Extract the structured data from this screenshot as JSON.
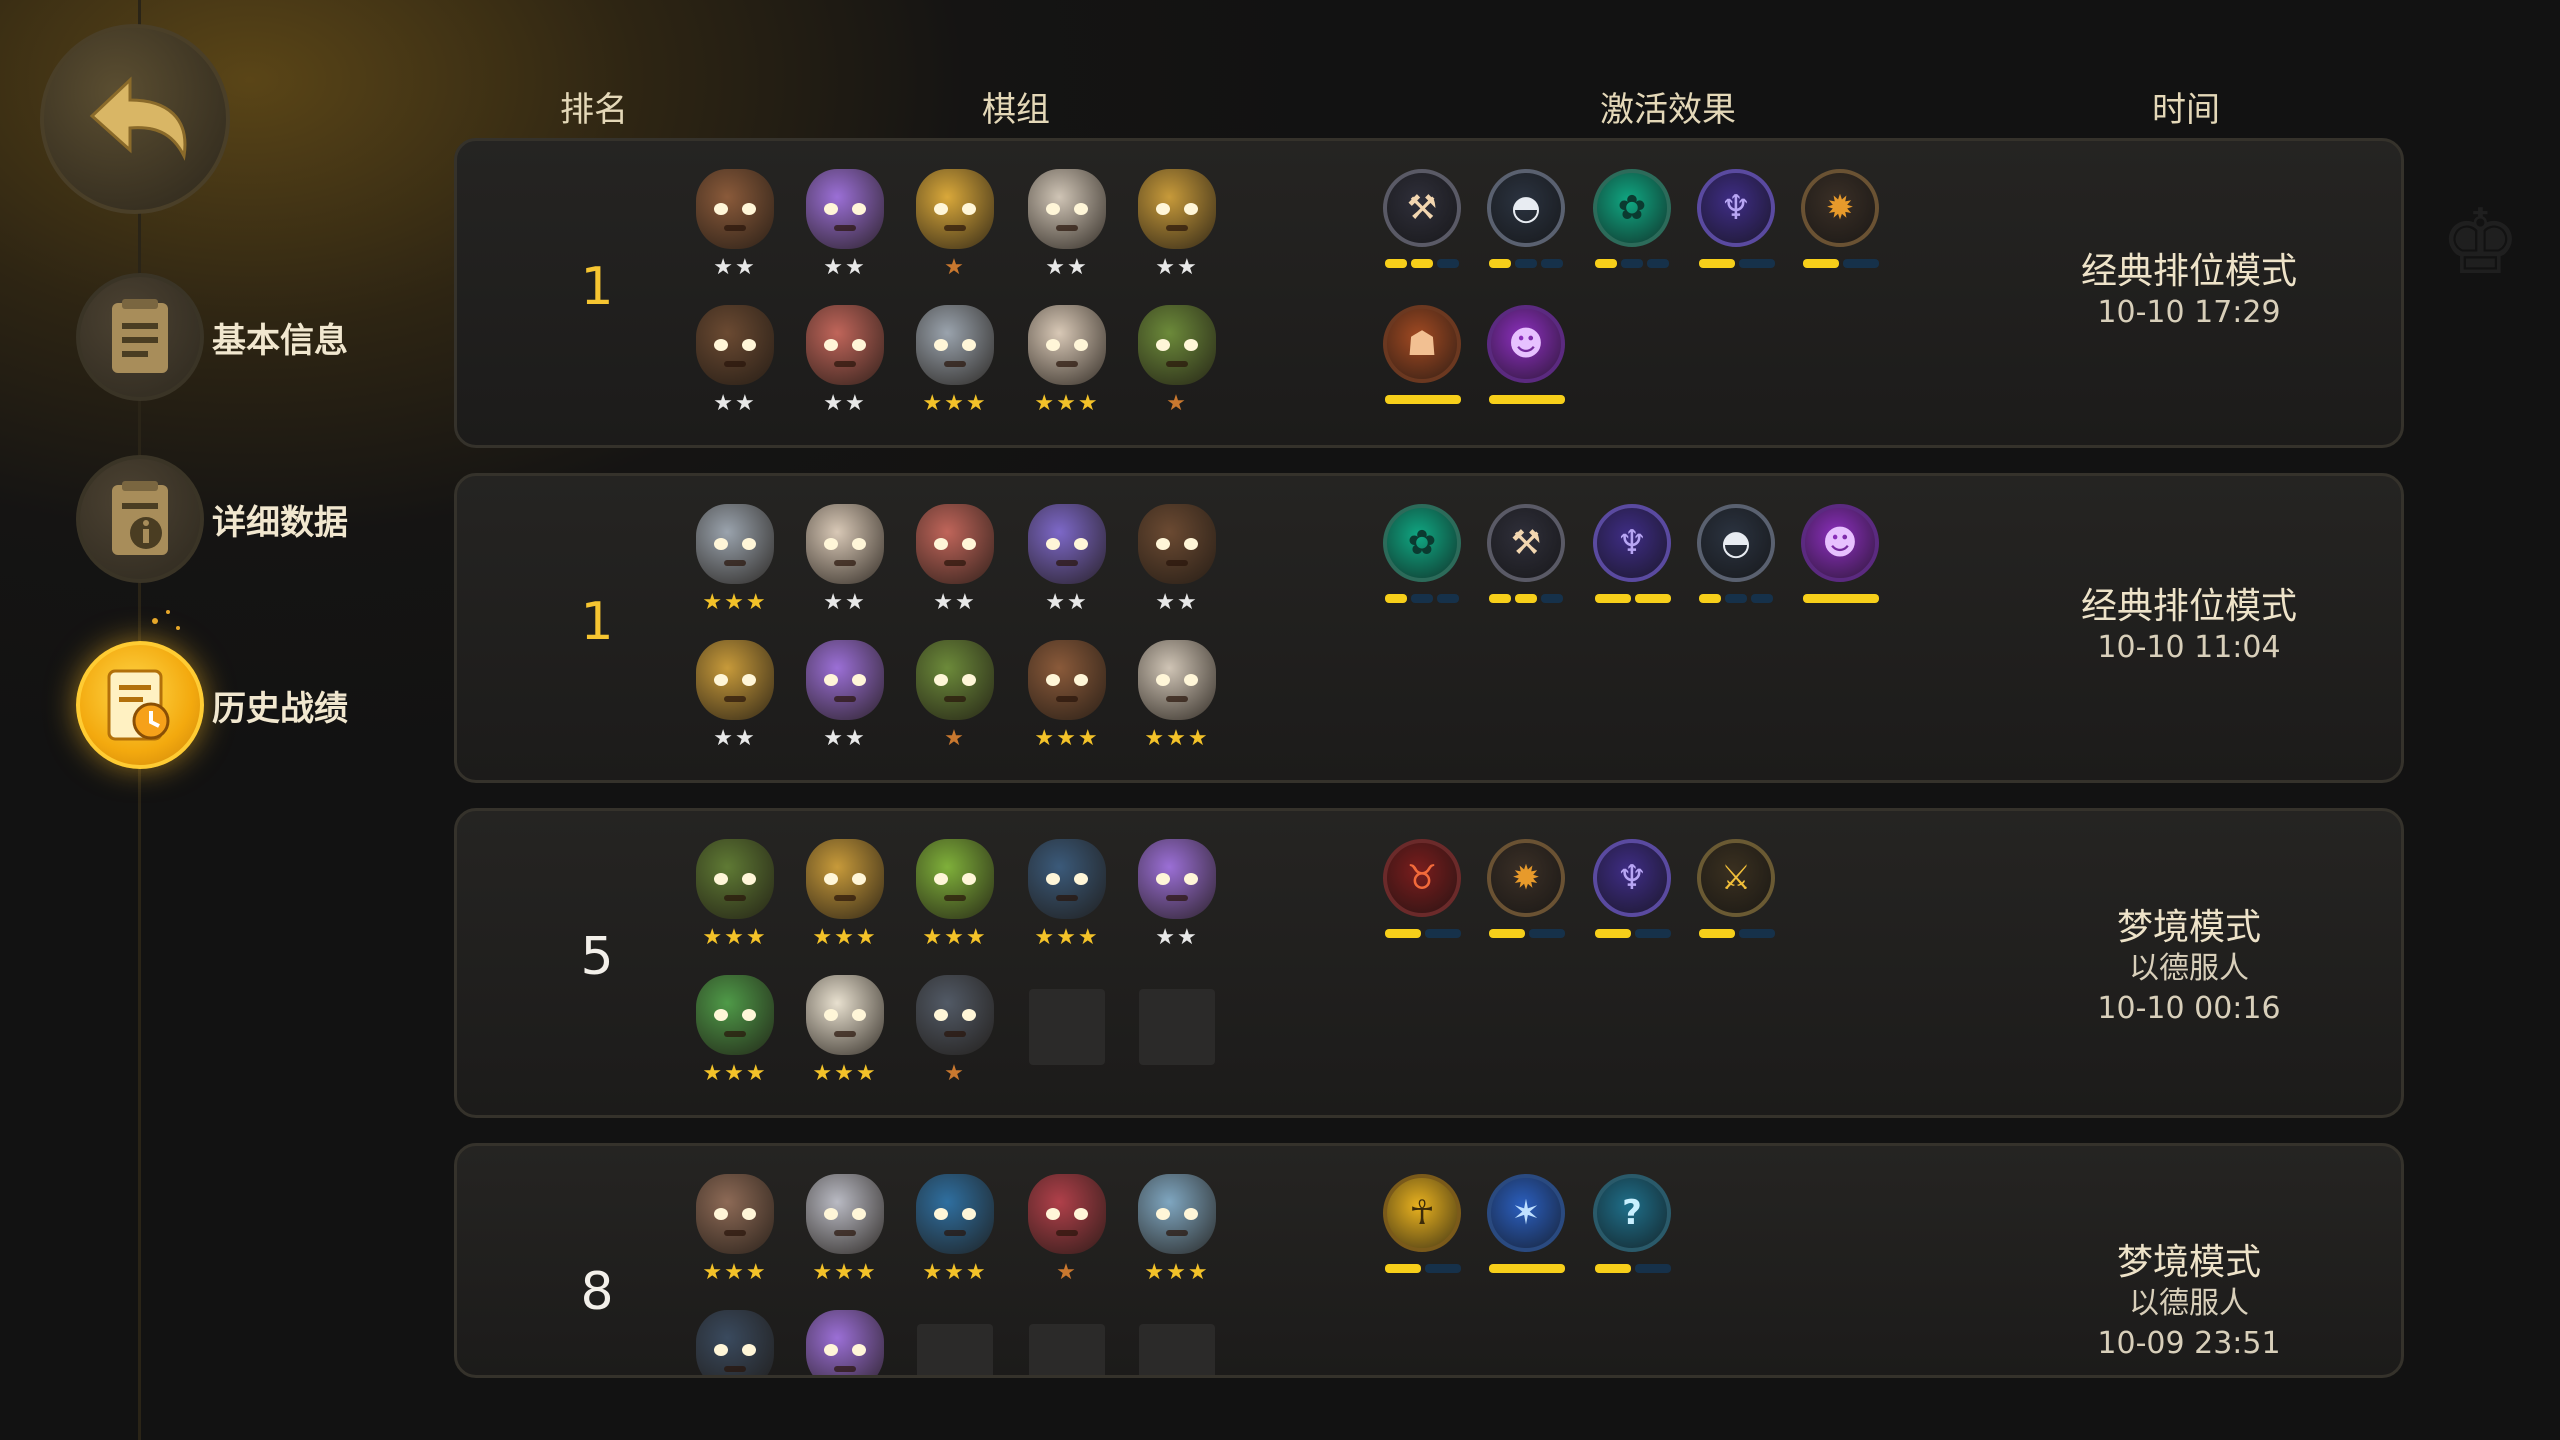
{
  "sidebar": {
    "back_icon": "back-arrow-icon",
    "items": [
      {
        "label": "基本信息",
        "icon": "document-icon",
        "active": false
      },
      {
        "label": "详细数据",
        "icon": "data-detail-icon",
        "active": false
      },
      {
        "label": "历史战绩",
        "icon": "history-clock-icon",
        "active": true
      }
    ]
  },
  "headers": {
    "rank": "排名",
    "lineup": "棋组",
    "effects": "激活效果",
    "time": "时间"
  },
  "colors": {
    "gold": "#f6c531",
    "accent": "#f7cf1a",
    "bar_off": "#16314a"
  },
  "records": [
    {
      "rank": "1",
      "mode": "经典排位模式",
      "sub": "",
      "time": "10-10 17:29",
      "pieces": [
        {
          "color": "#8a5a3a",
          "stars": 2
        },
        {
          "color": "#9b6fd6",
          "stars": 2
        },
        {
          "color": "#d9a83a",
          "stars": 1
        },
        {
          "color": "#cfc4b5",
          "stars": 2
        },
        {
          "color": "#c79a3a",
          "stars": 2
        },
        {
          "color": "#6b4a32",
          "stars": 2
        },
        {
          "color": "#c0655a",
          "stars": 2
        },
        {
          "color": "#9aa3ad",
          "stars": 3
        },
        {
          "color": "#d8c8b6",
          "stars": 3
        },
        {
          "color": "#6c8a3a",
          "stars": 1
        }
      ],
      "synergies": [
        {
          "icon": "axe-icon",
          "glyph": "⚒",
          "bg": "#2f2f3a",
          "fg": "#f2d6b0",
          "ring": "#5a5a66",
          "segments": 3,
          "active": 2,
          "row": 0
        },
        {
          "icon": "hat-icon",
          "glyph": "◓",
          "bg": "#2b3340",
          "fg": "#e8ecf2",
          "ring": "#5a6170",
          "segments": 3,
          "active": 1,
          "row": 0
        },
        {
          "icon": "paw-icon",
          "glyph": "✿",
          "bg": "#10a883",
          "fg": "#0b3a30",
          "ring": "#2c6b5a",
          "segments": 3,
          "active": 1,
          "row": 0
        },
        {
          "icon": "fish-icon",
          "glyph": "♆",
          "bg": "#3f2d86",
          "fg": "#b8a6f4",
          "ring": "#5a4aa0",
          "segments": 2,
          "active": 1,
          "row": 0
        },
        {
          "icon": "gear-icon",
          "glyph": "✹",
          "bg": "#3a2f26",
          "fg": "#e79a2b",
          "ring": "#6a5233",
          "segments": 2,
          "active": 1,
          "row": 0
        },
        {
          "icon": "horned-mask-icon",
          "glyph": "☗",
          "bg": "#a24a22",
          "fg": "#f2c092",
          "ring": "#6b3820",
          "segments": 1,
          "active": 1,
          "row": 1
        },
        {
          "icon": "demon-icon",
          "glyph": "☻",
          "bg": "#8d2fbf",
          "fg": "#e7c1ff",
          "ring": "#5b2a80",
          "segments": 1,
          "active": 1,
          "row": 1
        }
      ]
    },
    {
      "rank": "1",
      "mode": "经典排位模式",
      "sub": "",
      "time": "10-10 11:04",
      "pieces": [
        {
          "color": "#9aa3ad",
          "stars": 3
        },
        {
          "color": "#d8c8b6",
          "stars": 2
        },
        {
          "color": "#c0655a",
          "stars": 2
        },
        {
          "color": "#7d68c8",
          "stars": 2
        },
        {
          "color": "#6b4a32",
          "stars": 2
        },
        {
          "color": "#c79a3a",
          "stars": 2
        },
        {
          "color": "#9b6fd6",
          "stars": 2
        },
        {
          "color": "#6c8a3a",
          "stars": 1
        },
        {
          "color": "#8a5a3a",
          "stars": 3
        },
        {
          "color": "#cfc4b5",
          "stars": 3
        }
      ],
      "synergies": [
        {
          "icon": "paw-icon",
          "glyph": "✿",
          "bg": "#10a883",
          "fg": "#0b3a30",
          "ring": "#2c6b5a",
          "segments": 3,
          "active": 1,
          "row": 0
        },
        {
          "icon": "axe-icon",
          "glyph": "⚒",
          "bg": "#2f2f3a",
          "fg": "#f2d6b0",
          "ring": "#5a5a66",
          "segments": 3,
          "active": 2,
          "row": 0
        },
        {
          "icon": "fish-icon",
          "glyph": "♆",
          "bg": "#3f2d86",
          "fg": "#b8a6f4",
          "ring": "#5a4aa0",
          "segments": 2,
          "active": 2,
          "row": 0
        },
        {
          "icon": "hat-icon",
          "glyph": "◓",
          "bg": "#2b3340",
          "fg": "#e8ecf2",
          "ring": "#5a6170",
          "segments": 3,
          "active": 1,
          "row": 0
        },
        {
          "icon": "demon-icon",
          "glyph": "☻",
          "bg": "#8d2fbf",
          "fg": "#e7c1ff",
          "ring": "#5b2a80",
          "segments": 1,
          "active": 1,
          "row": 0
        }
      ]
    },
    {
      "rank": "5",
      "mode": "梦境模式",
      "sub": "以德服人",
      "time": "10-10 00:16",
      "pieces": [
        {
          "color": "#5f7a34",
          "stars": 3
        },
        {
          "color": "#c79a3a",
          "stars": 3
        },
        {
          "color": "#7fb03a",
          "stars": 3
        },
        {
          "color": "#3b5a7a",
          "stars": 3
        },
        {
          "color": "#9b6fd6",
          "stars": 2
        },
        {
          "color": "#4f9a48",
          "stars": 3
        },
        {
          "color": "#e8e0cf",
          "stars": 3
        },
        {
          "color": "#525a66",
          "stars": 1
        },
        {
          "empty": true
        },
        {
          "empty": true
        }
      ],
      "synergies": [
        {
          "icon": "bull-icon",
          "glyph": "♉",
          "bg": "#7a1d1d",
          "fg": "#f26a3a",
          "ring": "#6b2a2a",
          "segments": 2,
          "active": 1,
          "row": 0
        },
        {
          "icon": "gear-icon",
          "glyph": "✹",
          "bg": "#3a2f26",
          "fg": "#e79a2b",
          "ring": "#6a5233",
          "segments": 2,
          "active": 1,
          "row": 0
        },
        {
          "icon": "fish-icon",
          "glyph": "♆",
          "bg": "#3f2d86",
          "fg": "#b8a6f4",
          "ring": "#5a4aa0",
          "segments": 2,
          "active": 1,
          "row": 0
        },
        {
          "icon": "blades-icon",
          "glyph": "⚔",
          "bg": "#3a3020",
          "fg": "#f1bf3a",
          "ring": "#6a5a33",
          "segments": 2,
          "active": 1,
          "row": 0
        }
      ]
    },
    {
      "rank": "8",
      "mode": "梦境模式",
      "sub": "以德服人",
      "time": "10-09 23:51",
      "pieces": [
        {
          "color": "#8d6a56",
          "stars": 3
        },
        {
          "color": "#b9bac3",
          "stars": 3
        },
        {
          "color": "#2f6fa0",
          "stars": 3
        },
        {
          "color": "#b0404a",
          "stars": 1
        },
        {
          "color": "#7fa6c0",
          "stars": 3
        },
        {
          "color": "#3a4a5e",
          "stars": 0
        },
        {
          "color": "#9b6fd6",
          "stars": 0
        },
        {
          "empty": true
        },
        {
          "empty": true
        },
        {
          "empty": true
        }
      ],
      "synergies": [
        {
          "icon": "spirit-icon",
          "glyph": "☥",
          "bg": "#e9b21f",
          "fg": "#3a2a0a",
          "ring": "#7a5a1a",
          "segments": 2,
          "active": 1,
          "row": 0
        },
        {
          "icon": "wind-icon",
          "glyph": "✶",
          "bg": "#2b5fbf",
          "fg": "#bfe0ff",
          "ring": "#2a4a80",
          "segments": 1,
          "active": 1,
          "row": 0
        },
        {
          "icon": "mystery-icon",
          "glyph": "?",
          "bg": "#1f6f8a",
          "fg": "#c9f0ff",
          "ring": "#2a5a6a",
          "segments": 2,
          "active": 1,
          "row": 0
        }
      ]
    }
  ]
}
